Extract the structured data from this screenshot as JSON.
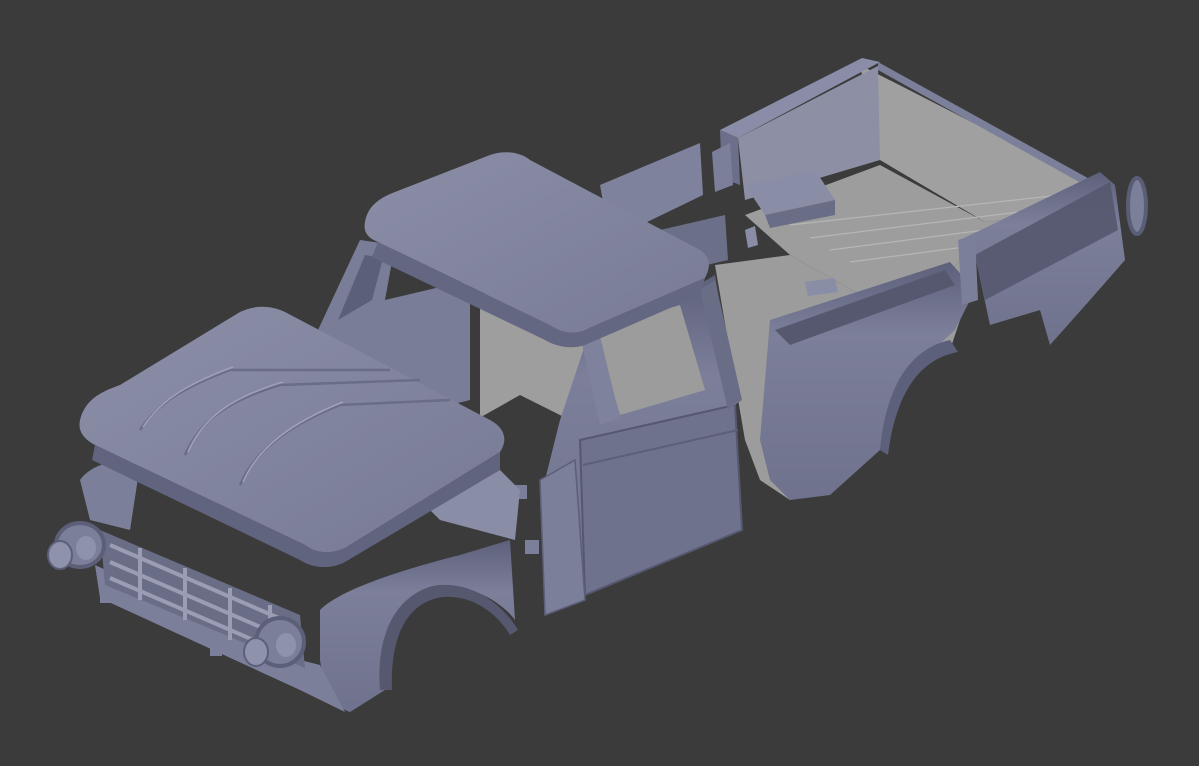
{
  "scene": {
    "model": "pickup-truck-body",
    "parts": [
      "bed-tub",
      "bed-floor",
      "cab",
      "cab-roof",
      "door",
      "hood",
      "front-fenders",
      "grille",
      "headlights",
      "spare-rim"
    ]
  },
  "colors": {
    "background": "#3b3b3b",
    "body": "#7c7f9a",
    "body_light": "#9396b0",
    "body_dark": "#5c5f78",
    "shadow": "#494b5e",
    "interior": "#8e8e8e",
    "interior_light": "#a3a3a3"
  }
}
